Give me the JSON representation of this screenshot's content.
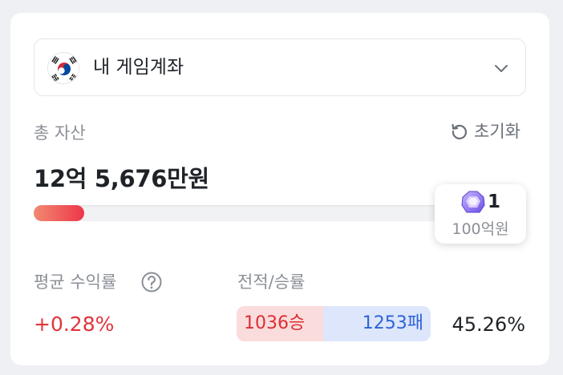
{
  "account": {
    "name": "내 게임계좌",
    "flag_icon": "korea-flag-icon",
    "dropdown_icon": "chevron-down-icon"
  },
  "assets": {
    "label": "총 자산",
    "reset_label": "초기화",
    "reset_icon": "refresh-icon",
    "total": "12억 5,676만원",
    "progress_fraction": 0.1257,
    "goal_icon": "purple-gem-icon",
    "goal_count": "1",
    "goal_unit": "100억원"
  },
  "stats": {
    "avg_return_label": "평균 수익률",
    "avg_return_help_icon": "question-circle-icon",
    "avg_return_value": "+0.28%",
    "record_label": "전적/승률",
    "wins": "1036승",
    "losses": "1253패",
    "win_rate": "45.26%"
  },
  "colors": {
    "accent_red": "#e0353b",
    "accent_blue": "#2e63d9",
    "progress_gradient_start": "#f08a72",
    "progress_gradient_end": "#ee3648"
  }
}
